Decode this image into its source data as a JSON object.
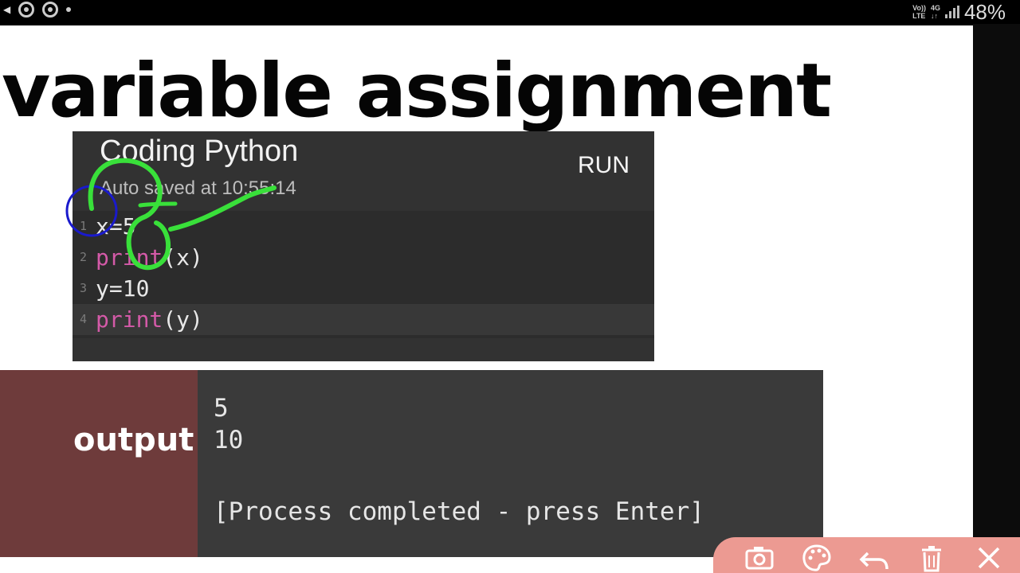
{
  "status_bar": {
    "network_line1": "Vo))",
    "network_line2": "LTE",
    "network_type": "4G",
    "battery": "48%"
  },
  "slide": {
    "title": "variable assignment"
  },
  "editor": {
    "title": "Coding Python",
    "autosave": "Auto saved at 10:55:14",
    "run_label": "RUN",
    "lines": [
      {
        "number": "1",
        "text": "x=5"
      },
      {
        "number": "2",
        "keyword": "print",
        "rest": "(x)"
      },
      {
        "number": "3",
        "text": "y=10"
      },
      {
        "number": "4",
        "keyword": "print",
        "rest": "(y)"
      }
    ]
  },
  "output": {
    "label": "output",
    "lines": [
      "5",
      "10",
      "[Process completed - press Enter]"
    ]
  },
  "toolbar": {
    "icons": [
      "camera-icon",
      "palette-icon",
      "undo-icon",
      "trash-icon",
      "close-icon"
    ]
  },
  "colors": {
    "keyword": "#d45aa8",
    "annotation_green": "#39e03a",
    "annotation_blue": "#1a1acc",
    "output_label_bg": "#6e3b3b",
    "toolbar_bg": "#ec9a92"
  }
}
